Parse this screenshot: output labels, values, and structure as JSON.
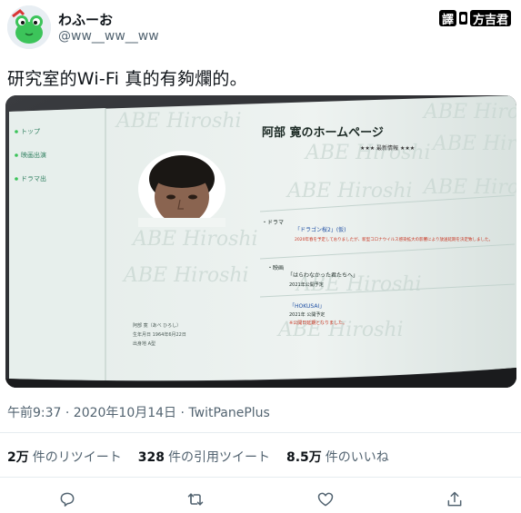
{
  "user": {
    "display_name": "わふーお",
    "handle": "@ww__ww__ww"
  },
  "watermark": {
    "label_a": "譯",
    "label_b": "方吉君"
  },
  "tweet": {
    "text": "研究室的Wi-Fi 真的有夠爛的。"
  },
  "screen_photo": {
    "page_title": "阿部 寛のホームページ",
    "stars_line": "★★★ 最新情報 ★★★",
    "watermark_text": "ABE Hiroshi",
    "nav": [
      "トップ",
      "映画出演",
      "ドラマ出"
    ],
    "sections": [
      {
        "label": "・ドラマ",
        "title": "「ドラゴン桜2」(仮)",
        "note": "2020年春を予定しておりましたが、新型コロナウイルス感染拡大の影響により放送延期を決定致しました。"
      },
      {
        "label": "・映画",
        "title": "「はらわなかった君たちへ」",
        "note": "2021年公開予定"
      },
      {
        "label": "",
        "title": "「HOKUSAI」",
        "note": "2021年 公開予定",
        "extra": "※公開日延期となりました。"
      }
    ],
    "profile": [
      "阿部 寛（あべ ひろし）",
      "生年月日 1964年6月22日",
      "出身地 A型"
    ]
  },
  "meta": {
    "timestamp": "午前9:37 · 2020年10月14日 · TwitPanePlus"
  },
  "stats": {
    "retweets_count": "2万",
    "retweets_label": "件のリツイート",
    "quotes_count": "328",
    "quotes_label": "件の引用ツイート",
    "likes_count": "8.5万",
    "likes_label": "件のいいね"
  },
  "icons": {
    "reply": "reply-icon",
    "retweet": "retweet-icon",
    "like": "heart-icon",
    "share": "share-icon"
  },
  "colors": {
    "text_primary": "#0f1419",
    "text_secondary": "#536471",
    "avatar_bg": "#dfe7ee",
    "frog_green": "#3cc45a"
  }
}
